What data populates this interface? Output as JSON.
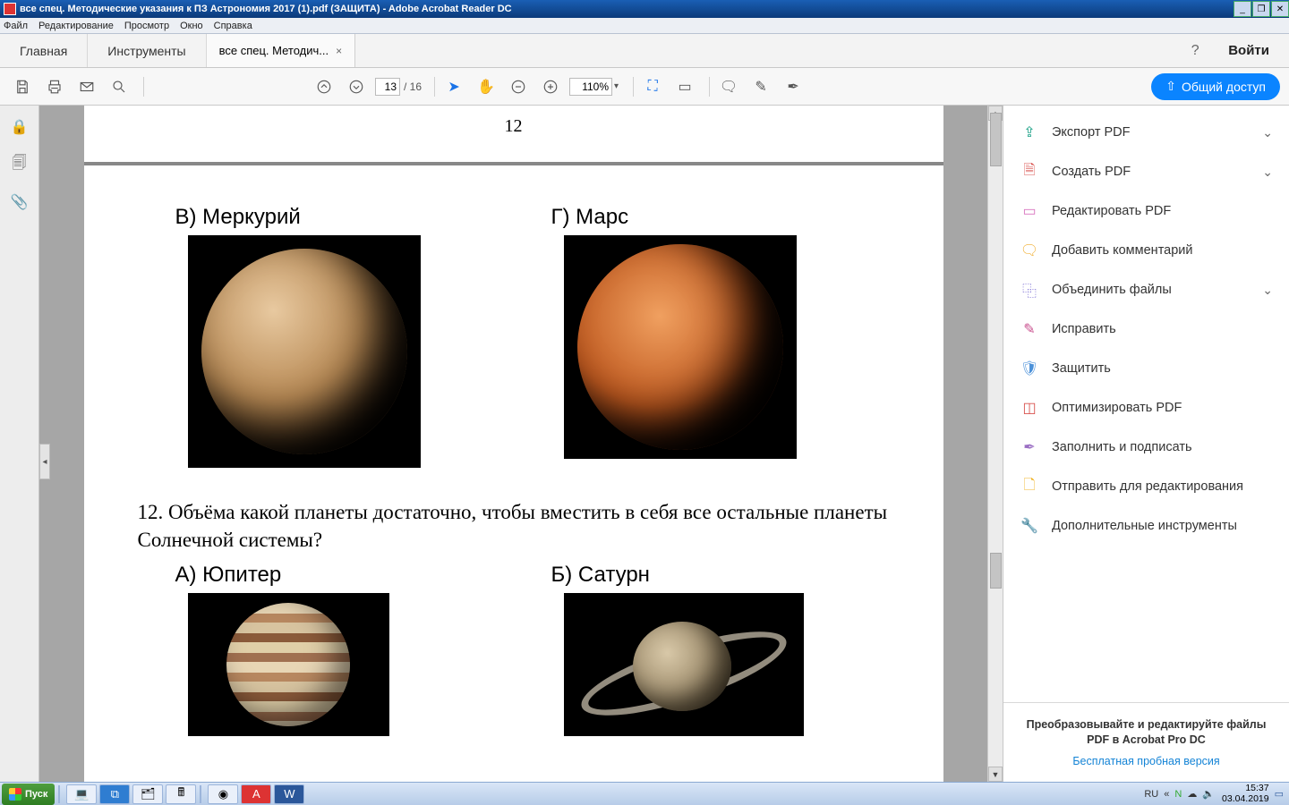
{
  "window": {
    "title": "все спец. Методические указания к ПЗ Астрономия 2017 (1).pdf (ЗАЩИТА) - Adobe Acrobat Reader DC"
  },
  "menubar": [
    "Файл",
    "Редактирование",
    "Просмотр",
    "Окно",
    "Справка"
  ],
  "tabs": {
    "home": "Главная",
    "tools": "Инструменты",
    "doc": "все спец. Методич...",
    "signin": "Войти"
  },
  "toolbar": {
    "page_current": "13",
    "page_total": "/ 16",
    "zoom": "110%",
    "share": "Общий доступ"
  },
  "document": {
    "page_number": "12",
    "answer_b_label": "В) Меркурий",
    "answer_g_label": "Г) Марс",
    "question12": "12. Объёма какой планеты достаточно, чтобы вместить в себя все остальные планеты Солнечной системы?",
    "answer_a2_label": "А) Юпитер",
    "answer_b2_label": "Б) Сатурн"
  },
  "right_tools": {
    "items": [
      {
        "label": "Экспорт PDF",
        "icon_class": "ic-export",
        "glyph": "⇪",
        "chevron": true
      },
      {
        "label": "Создать PDF",
        "icon_class": "ic-create",
        "glyph": "🗎",
        "chevron": true
      },
      {
        "label": "Редактировать PDF",
        "icon_class": "ic-edit",
        "glyph": "▭",
        "chevron": false
      },
      {
        "label": "Добавить комментарий",
        "icon_class": "ic-comment",
        "glyph": "🗨",
        "chevron": false
      },
      {
        "label": "Объединить файлы",
        "icon_class": "ic-combine",
        "glyph": "⿻",
        "chevron": true
      },
      {
        "label": "Исправить",
        "icon_class": "ic-redact",
        "glyph": "✎",
        "chevron": false
      },
      {
        "label": "Защитить",
        "icon_class": "ic-protect",
        "glyph": "🛡",
        "chevron": false
      },
      {
        "label": "Оптимизировать PDF",
        "icon_class": "ic-optimize",
        "glyph": "◫",
        "chevron": false
      },
      {
        "label": "Заполнить и подписать",
        "icon_class": "ic-fill",
        "glyph": "✒",
        "chevron": false
      },
      {
        "label": "Отправить для редактирования",
        "icon_class": "ic-send",
        "glyph": "🗋",
        "chevron": false
      },
      {
        "label": "Дополнительные инструменты",
        "icon_class": "ic-more",
        "glyph": "🔧",
        "chevron": false
      }
    ],
    "promo_line1": "Преобразовывайте и редактируйте файлы PDF в Acrobat Pro DC",
    "promo_link": "Бесплатная пробная версия"
  },
  "taskbar": {
    "start": "Пуск",
    "lang": "RU",
    "time": "15:37",
    "date": "03.04.2019"
  }
}
